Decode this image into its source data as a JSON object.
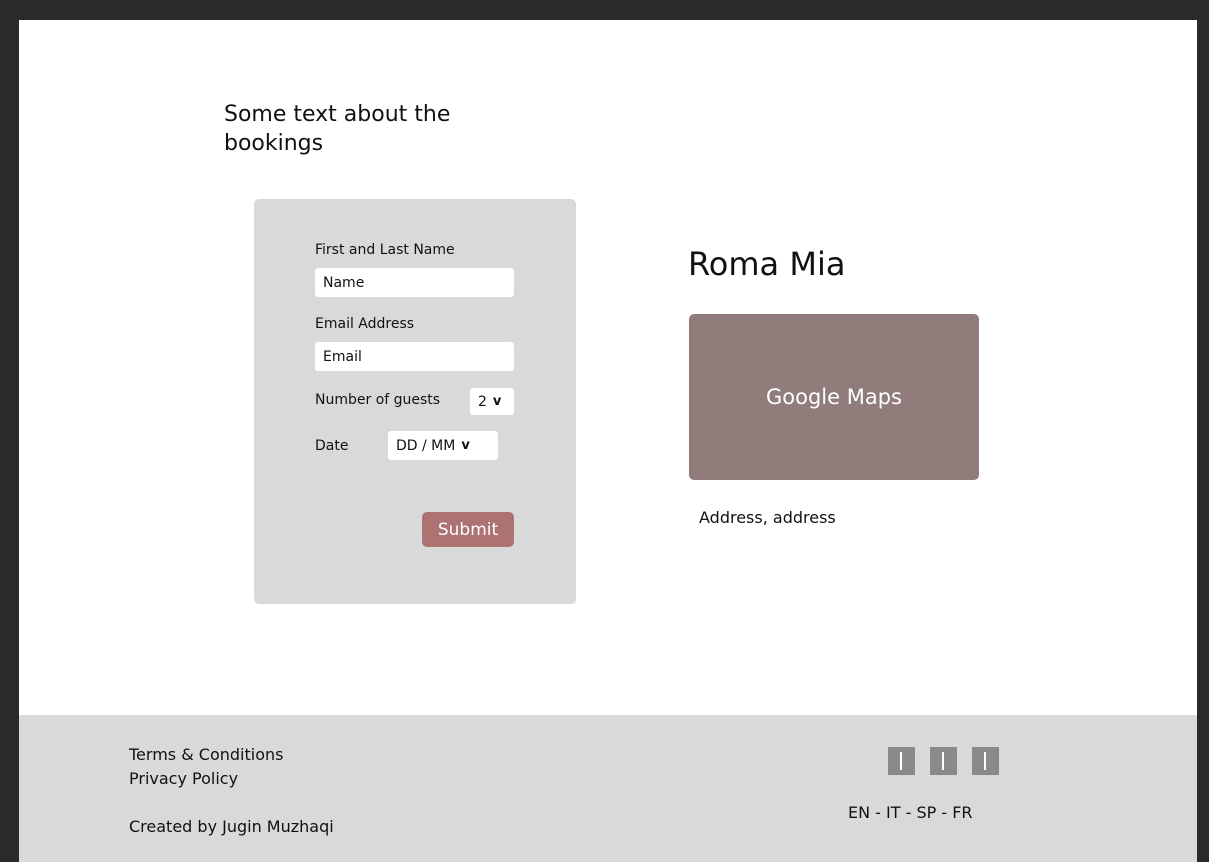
{
  "intro": {
    "text": "Some text about the bookings"
  },
  "form": {
    "name_label": "First and Last Name",
    "name_placeholder": "Name",
    "email_label": "Email Address",
    "email_placeholder": "Email",
    "guests_label": "Number of guests",
    "guests_value": "2",
    "date_label": "Date",
    "date_value": "DD / MM",
    "submit_label": "Submit"
  },
  "venue": {
    "title": "Roma Mia",
    "map_label": "Google Maps",
    "address": "Address, address"
  },
  "footer": {
    "terms": "Terms & Conditions",
    "privacy": "Privacy Policy",
    "credit": "Created by Jugin Muzhaqi",
    "languages": "EN - IT - SP - FR",
    "social_icons": [
      "social-icon",
      "social-icon",
      "social-icon"
    ]
  },
  "colors": {
    "submit": "#ad7272",
    "map": "#917c7c",
    "card": "#d9d9d9",
    "footer": "#d9d9d9"
  }
}
